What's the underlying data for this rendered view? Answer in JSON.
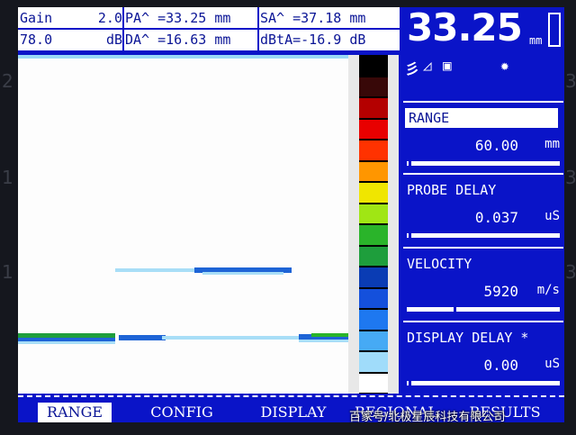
{
  "header": {
    "gain_label": "Gain",
    "gain_value": "2.0",
    "gain_base": "78.0",
    "gain_unit": "dB",
    "pa": "PA^ =33.25 mm",
    "da": "DA^ =16.63 mm",
    "sa": "SA^ =37.18 mm",
    "dbta": "dBtA=-16.9 dB",
    "big_value": "33.25",
    "big_unit": "mm"
  },
  "status_icons": {
    "probe": "彡",
    "signal": "◿",
    "memory": "▣",
    "star": "✹"
  },
  "params": [
    {
      "label": "RANGE",
      "value": "60.00",
      "unit": "mm",
      "selected": true
    },
    {
      "label": "PROBE DELAY",
      "value": "0.037",
      "unit": "uS",
      "selected": false
    },
    {
      "label": "VELOCITY",
      "value": "5920",
      "unit": "m/s",
      "selected": false
    },
    {
      "label": "DISPLAY DELAY *",
      "value": "0.00",
      "unit": "uS",
      "selected": false
    }
  ],
  "softkeys": [
    "RANGE",
    "CONFIG",
    "DISPLAY",
    "REGIONAL",
    "RESULTS"
  ],
  "active_softkey": "RANGE",
  "palette_colors": [
    "#000000",
    "#380808",
    "#b40000",
    "#e80000",
    "#ff3200",
    "#ff9600",
    "#f0e600",
    "#a0e614",
    "#2ab42a",
    "#1e9e3c",
    "#0a3cb4",
    "#1450dc",
    "#1e78f0",
    "#46aaf5",
    "#a0dcfa",
    "#ffffff"
  ],
  "watermark": "百家号/北极星辰科技有限公司",
  "bezel_marks": [
    "2",
    "3",
    "1",
    "3",
    "1",
    "3"
  ]
}
